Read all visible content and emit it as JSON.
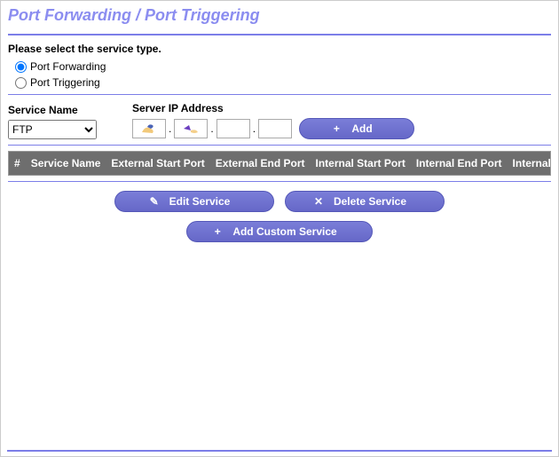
{
  "title": "Port Forwarding / Port Triggering",
  "prompt": "Please select the service type.",
  "radios": {
    "forwarding": "Port Forwarding",
    "triggering": "Port Triggering"
  },
  "selected_radio": "forwarding",
  "service_name_label": "Service Name",
  "service_name_value": "FTP",
  "server_ip_label": "Server IP Address",
  "ip": {
    "o1": "",
    "o2": "",
    "o3": "",
    "o4": ""
  },
  "buttons": {
    "add": "Add",
    "edit": "Edit Service",
    "delete": "Delete Service",
    "custom": "Add Custom Service"
  },
  "table": {
    "headers": [
      "#",
      "Service Name",
      "External Start Port",
      "External End Port",
      "Internal Start Port",
      "Internal End Port",
      "Internal"
    ]
  }
}
